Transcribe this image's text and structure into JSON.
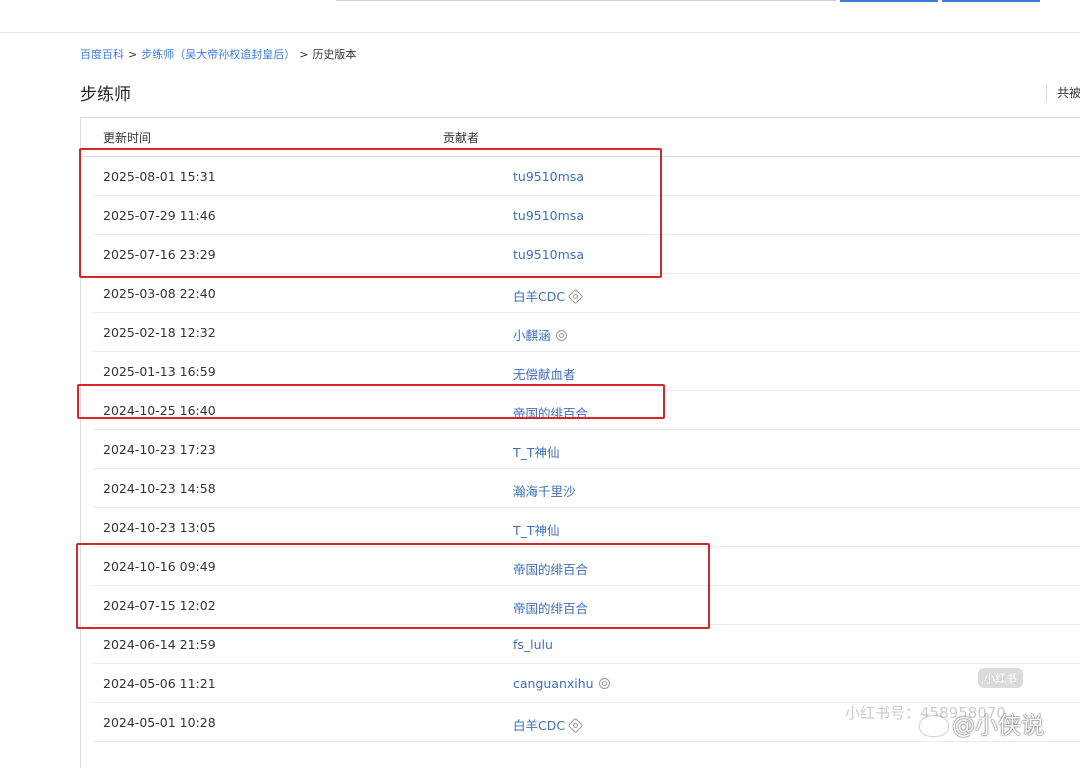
{
  "breadcrumb": {
    "home": "百度百科",
    "sep1": ">",
    "entry": "步练师（吴大帝孙权追封皇后）",
    "sep2": ">",
    "current": "历史版本"
  },
  "page_title": "步练师",
  "side_link": "共被",
  "table": {
    "headers": {
      "time": "更新时间",
      "contributor": "贡献者"
    },
    "rows": [
      {
        "time": "2025-08-01 15:31",
        "user": "tu9510msa"
      },
      {
        "time": "2025-07-29 11:46",
        "user": "tu9510msa"
      },
      {
        "time": "2025-07-16 23:29",
        "user": "tu9510msa"
      },
      {
        "time": "2025-03-08 22:40",
        "user": "白羊CDC",
        "badge": "hex-badge-icon"
      },
      {
        "time": "2025-02-18 12:32",
        "user": "小麒涵",
        "badge": "user-badge-icon"
      },
      {
        "time": "2025-01-13 16:59",
        "user": "无偿献血者"
      },
      {
        "time": "2024-10-25 16:40",
        "user": "帝国的绯百合"
      },
      {
        "time": "2024-10-23 17:23",
        "user": "T_T神仙"
      },
      {
        "time": "2024-10-23 14:58",
        "user": "瀚海千里沙"
      },
      {
        "time": "2024-10-23 13:05",
        "user": "T_T神仙"
      },
      {
        "time": "2024-10-16 09:49",
        "user": "帝国的绯百合"
      },
      {
        "time": "2024-07-15 12:02",
        "user": "帝国的绯百合"
      },
      {
        "time": "2024-06-14 21:59",
        "user": "fs_lulu"
      },
      {
        "time": "2024-05-06 11:21",
        "user": "canguanxihu",
        "badge": "user-badge-icon"
      },
      {
        "time": "2024-05-01 10:28",
        "user": "白羊CDC",
        "badge": "hex-badge-icon"
      }
    ]
  },
  "watermarks": {
    "app": "小红书",
    "id_label": "小红书号：",
    "id_value": "458958070",
    "weibo": "@小侠说"
  },
  "colors": {
    "link": "#3e6fb8",
    "highlight": "#d3272d"
  }
}
